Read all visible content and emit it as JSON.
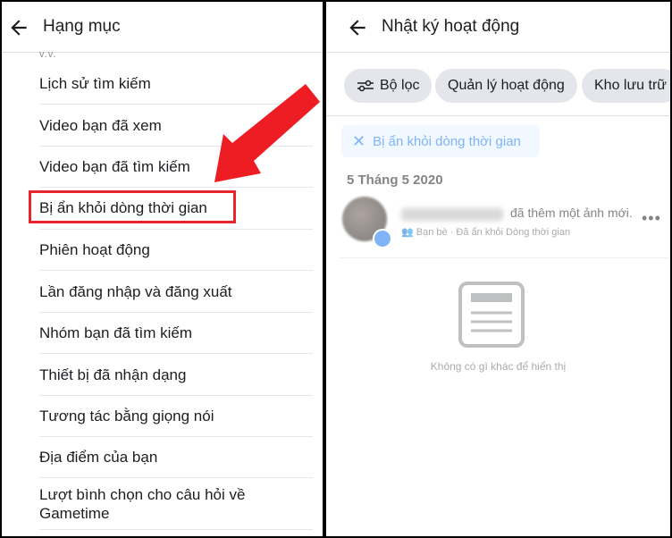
{
  "left_panel": {
    "title": "Hạng mục",
    "truncated_top": "v.v.",
    "items": [
      "Lịch sử tìm kiếm",
      "Video bạn đã xem",
      "Video bạn đã tìm kiếm",
      "Bị ẩn khỏi dòng thời gian",
      "Phiên hoạt động",
      "Lần đăng nhập và đăng xuất",
      "Nhóm bạn đã tìm kiếm",
      "Thiết bị đã nhận dạng",
      "Tương tác bằng giọng nói",
      "Địa điểm của bạn",
      "Lượt bình chọn cho câu hỏi về Gametime"
    ],
    "highlighted_index": 3
  },
  "right_panel": {
    "title": "Nhật ký hoạt động",
    "chips": [
      "Bộ lọc",
      "Quản lý hoạt động",
      "Kho lưu trữ"
    ],
    "active_filter": "Bị ẩn khỏi dòng thời gian",
    "date_heading": "5 Tháng 5 2020",
    "activity": {
      "text": "đã thêm một ảnh mới.",
      "meta": "Bạn bè · Đã ẩn khỏi Dòng thời gian"
    },
    "empty_message": "Không có gì khác để hiển thị"
  },
  "icons": {
    "back": "arrow-left-icon",
    "filter": "sliders-icon",
    "close": "close-icon",
    "more": "more-dots-icon",
    "empty": "document-icon",
    "friends": "friends-icon"
  },
  "colors": {
    "highlight": "#e8262c",
    "arrow": "#ee1c23",
    "accent": "#1877f2",
    "chip_bg": "#e4e6eb",
    "tag_bg": "#e7f3ff"
  }
}
